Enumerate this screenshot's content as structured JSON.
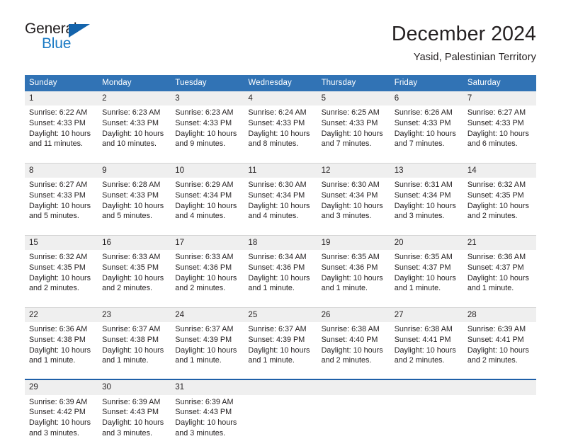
{
  "logo": {
    "word_one": "General",
    "word_two": "Blue",
    "triangle_color": "#1464ac",
    "blue_text_color": "#1a7ac4"
  },
  "header": {
    "title": "December 2024",
    "subtitle": "Yasid, Palestinian Territory",
    "header_bg": "#3173b5",
    "daynum_bg": "#efefef"
  },
  "weekdays": [
    "Sunday",
    "Monday",
    "Tuesday",
    "Wednesday",
    "Thursday",
    "Friday",
    "Saturday"
  ],
  "weeks": [
    {
      "separator": "none",
      "days": [
        {
          "num": "1",
          "sunrise": "Sunrise: 6:22 AM",
          "sunset": "Sunset: 4:33 PM",
          "daylight_1": "Daylight: 10 hours",
          "daylight_2": "and 11 minutes."
        },
        {
          "num": "2",
          "sunrise": "Sunrise: 6:23 AM",
          "sunset": "Sunset: 4:33 PM",
          "daylight_1": "Daylight: 10 hours",
          "daylight_2": "and 10 minutes."
        },
        {
          "num": "3",
          "sunrise": "Sunrise: 6:23 AM",
          "sunset": "Sunset: 4:33 PM",
          "daylight_1": "Daylight: 10 hours",
          "daylight_2": "and 9 minutes."
        },
        {
          "num": "4",
          "sunrise": "Sunrise: 6:24 AM",
          "sunset": "Sunset: 4:33 PM",
          "daylight_1": "Daylight: 10 hours",
          "daylight_2": "and 8 minutes."
        },
        {
          "num": "5",
          "sunrise": "Sunrise: 6:25 AM",
          "sunset": "Sunset: 4:33 PM",
          "daylight_1": "Daylight: 10 hours",
          "daylight_2": "and 7 minutes."
        },
        {
          "num": "6",
          "sunrise": "Sunrise: 6:26 AM",
          "sunset": "Sunset: 4:33 PM",
          "daylight_1": "Daylight: 10 hours",
          "daylight_2": "and 7 minutes."
        },
        {
          "num": "7",
          "sunrise": "Sunrise: 6:27 AM",
          "sunset": "Sunset: 4:33 PM",
          "daylight_1": "Daylight: 10 hours",
          "daylight_2": "and 6 minutes."
        }
      ]
    },
    {
      "separator": "gray",
      "days": [
        {
          "num": "8",
          "sunrise": "Sunrise: 6:27 AM",
          "sunset": "Sunset: 4:33 PM",
          "daylight_1": "Daylight: 10 hours",
          "daylight_2": "and 5 minutes."
        },
        {
          "num": "9",
          "sunrise": "Sunrise: 6:28 AM",
          "sunset": "Sunset: 4:33 PM",
          "daylight_1": "Daylight: 10 hours",
          "daylight_2": "and 5 minutes."
        },
        {
          "num": "10",
          "sunrise": "Sunrise: 6:29 AM",
          "sunset": "Sunset: 4:34 PM",
          "daylight_1": "Daylight: 10 hours",
          "daylight_2": "and 4 minutes."
        },
        {
          "num": "11",
          "sunrise": "Sunrise: 6:30 AM",
          "sunset": "Sunset: 4:34 PM",
          "daylight_1": "Daylight: 10 hours",
          "daylight_2": "and 4 minutes."
        },
        {
          "num": "12",
          "sunrise": "Sunrise: 6:30 AM",
          "sunset": "Sunset: 4:34 PM",
          "daylight_1": "Daylight: 10 hours",
          "daylight_2": "and 3 minutes."
        },
        {
          "num": "13",
          "sunrise": "Sunrise: 6:31 AM",
          "sunset": "Sunset: 4:34 PM",
          "daylight_1": "Daylight: 10 hours",
          "daylight_2": "and 3 minutes."
        },
        {
          "num": "14",
          "sunrise": "Sunrise: 6:32 AM",
          "sunset": "Sunset: 4:35 PM",
          "daylight_1": "Daylight: 10 hours",
          "daylight_2": "and 2 minutes."
        }
      ]
    },
    {
      "separator": "gray",
      "days": [
        {
          "num": "15",
          "sunrise": "Sunrise: 6:32 AM",
          "sunset": "Sunset: 4:35 PM",
          "daylight_1": "Daylight: 10 hours",
          "daylight_2": "and 2 minutes."
        },
        {
          "num": "16",
          "sunrise": "Sunrise: 6:33 AM",
          "sunset": "Sunset: 4:35 PM",
          "daylight_1": "Daylight: 10 hours",
          "daylight_2": "and 2 minutes."
        },
        {
          "num": "17",
          "sunrise": "Sunrise: 6:33 AM",
          "sunset": "Sunset: 4:36 PM",
          "daylight_1": "Daylight: 10 hours",
          "daylight_2": "and 2 minutes."
        },
        {
          "num": "18",
          "sunrise": "Sunrise: 6:34 AM",
          "sunset": "Sunset: 4:36 PM",
          "daylight_1": "Daylight: 10 hours",
          "daylight_2": "and 1 minute."
        },
        {
          "num": "19",
          "sunrise": "Sunrise: 6:35 AM",
          "sunset": "Sunset: 4:36 PM",
          "daylight_1": "Daylight: 10 hours",
          "daylight_2": "and 1 minute."
        },
        {
          "num": "20",
          "sunrise": "Sunrise: 6:35 AM",
          "sunset": "Sunset: 4:37 PM",
          "daylight_1": "Daylight: 10 hours",
          "daylight_2": "and 1 minute."
        },
        {
          "num": "21",
          "sunrise": "Sunrise: 6:36 AM",
          "sunset": "Sunset: 4:37 PM",
          "daylight_1": "Daylight: 10 hours",
          "daylight_2": "and 1 minute."
        }
      ]
    },
    {
      "separator": "gray",
      "days": [
        {
          "num": "22",
          "sunrise": "Sunrise: 6:36 AM",
          "sunset": "Sunset: 4:38 PM",
          "daylight_1": "Daylight: 10 hours",
          "daylight_2": "and 1 minute."
        },
        {
          "num": "23",
          "sunrise": "Sunrise: 6:37 AM",
          "sunset": "Sunset: 4:38 PM",
          "daylight_1": "Daylight: 10 hours",
          "daylight_2": "and 1 minute."
        },
        {
          "num": "24",
          "sunrise": "Sunrise: 6:37 AM",
          "sunset": "Sunset: 4:39 PM",
          "daylight_1": "Daylight: 10 hours",
          "daylight_2": "and 1 minute."
        },
        {
          "num": "25",
          "sunrise": "Sunrise: 6:37 AM",
          "sunset": "Sunset: 4:39 PM",
          "daylight_1": "Daylight: 10 hours",
          "daylight_2": "and 1 minute."
        },
        {
          "num": "26",
          "sunrise": "Sunrise: 6:38 AM",
          "sunset": "Sunset: 4:40 PM",
          "daylight_1": "Daylight: 10 hours",
          "daylight_2": "and 2 minutes."
        },
        {
          "num": "27",
          "sunrise": "Sunrise: 6:38 AM",
          "sunset": "Sunset: 4:41 PM",
          "daylight_1": "Daylight: 10 hours",
          "daylight_2": "and 2 minutes."
        },
        {
          "num": "28",
          "sunrise": "Sunrise: 6:39 AM",
          "sunset": "Sunset: 4:41 PM",
          "daylight_1": "Daylight: 10 hours",
          "daylight_2": "and 2 minutes."
        }
      ]
    },
    {
      "separator": "blue",
      "days": [
        {
          "num": "29",
          "sunrise": "Sunrise: 6:39 AM",
          "sunset": "Sunset: 4:42 PM",
          "daylight_1": "Daylight: 10 hours",
          "daylight_2": "and 3 minutes."
        },
        {
          "num": "30",
          "sunrise": "Sunrise: 6:39 AM",
          "sunset": "Sunset: 4:43 PM",
          "daylight_1": "Daylight: 10 hours",
          "daylight_2": "and 3 minutes."
        },
        {
          "num": "31",
          "sunrise": "Sunrise: 6:39 AM",
          "sunset": "Sunset: 4:43 PM",
          "daylight_1": "Daylight: 10 hours",
          "daylight_2": "and 3 minutes."
        },
        {
          "num": "",
          "sunrise": "",
          "sunset": "",
          "daylight_1": "",
          "daylight_2": ""
        },
        {
          "num": "",
          "sunrise": "",
          "sunset": "",
          "daylight_1": "",
          "daylight_2": ""
        },
        {
          "num": "",
          "sunrise": "",
          "sunset": "",
          "daylight_1": "",
          "daylight_2": ""
        },
        {
          "num": "",
          "sunrise": "",
          "sunset": "",
          "daylight_1": "",
          "daylight_2": ""
        }
      ]
    }
  ]
}
